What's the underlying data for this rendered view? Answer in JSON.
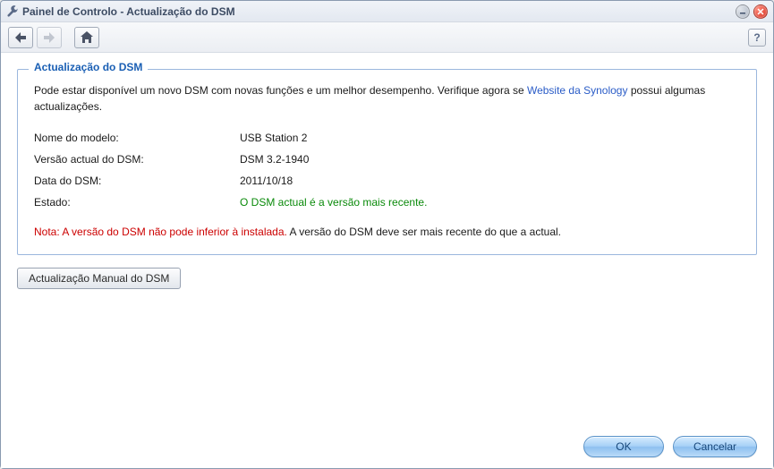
{
  "window": {
    "title": "Painel de Controlo - Actualização do DSM"
  },
  "toolbar": {
    "help_label": "?"
  },
  "fieldset": {
    "legend": "Actualização do DSM",
    "intro_before": "Pode estar disponível um novo DSM com novas funções e um melhor desempenho. Verifique agora se ",
    "intro_link": "Website da Synology",
    "intro_after": " possui algumas actualizações.",
    "rows": {
      "model_label": "Nome do modelo:",
      "model_value": "USB Station 2",
      "version_label": "Versão actual do DSM:",
      "version_value": "DSM 3.2-1940",
      "date_label": "Data do DSM:",
      "date_value": "2011/10/18",
      "status_label": "Estado:",
      "status_value": "O DSM actual é a versão mais recente."
    },
    "note_red": "Nota: A versão do DSM não pode inferior à instalada.",
    "note_rest": " A versão do DSM deve ser mais recente do que a actual."
  },
  "buttons": {
    "manual_update": "Actualização Manual do DSM",
    "ok": "OK",
    "cancel": "Cancelar"
  }
}
